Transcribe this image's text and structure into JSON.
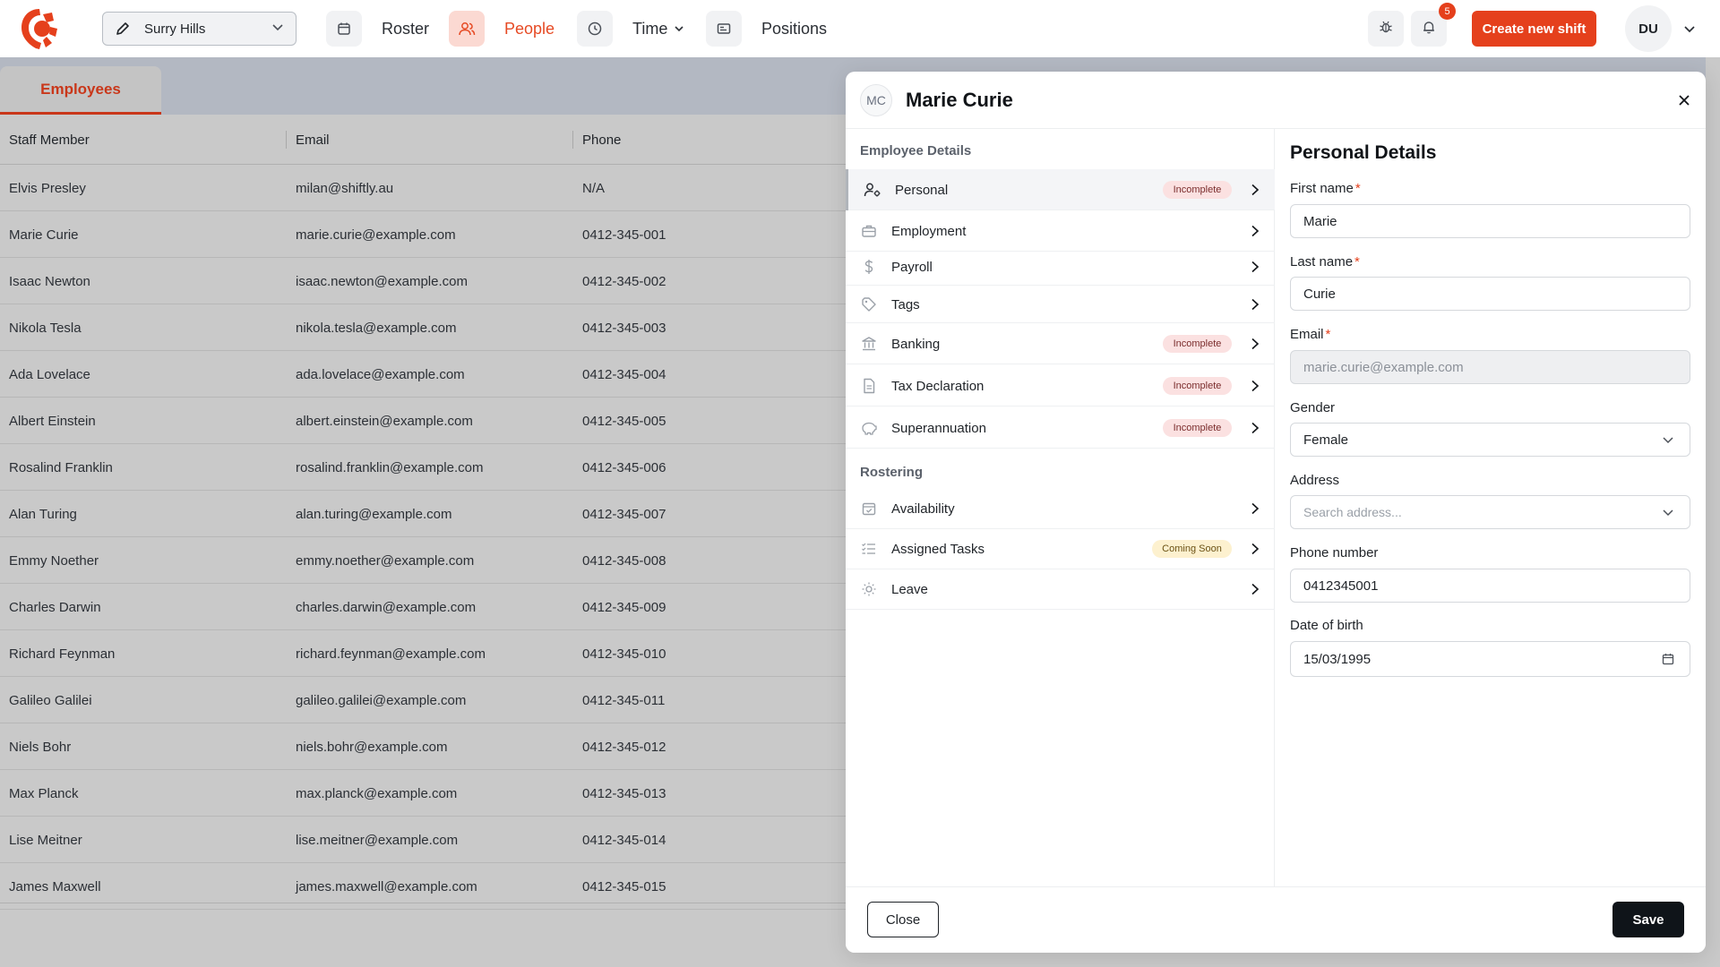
{
  "colors": {
    "brand": "#e5401c",
    "active_nav": "#e64a24",
    "dim_overlay": "#c9c9c9"
  },
  "topbar": {
    "location": "Surry Hills",
    "nav": [
      {
        "label": "Roster",
        "icon": "calendar-icon"
      },
      {
        "label": "People",
        "icon": "people-icon",
        "active": true
      },
      {
        "label": "Time",
        "icon": "clock-icon"
      },
      {
        "label": "Positions",
        "icon": "id-card-icon"
      }
    ],
    "notification_count": "5",
    "create_button": "Create new shift",
    "user_initials": "DU"
  },
  "page": {
    "tab": "Employees",
    "columns": [
      "Staff Member",
      "Email",
      "Phone"
    ],
    "rows": [
      [
        "Elvis Presley",
        "milan@shiftly.au",
        "N/A"
      ],
      [
        "Marie Curie",
        "marie.curie@example.com",
        "0412-345-001"
      ],
      [
        "Isaac Newton",
        "isaac.newton@example.com",
        "0412-345-002"
      ],
      [
        "Nikola Tesla",
        "nikola.tesla@example.com",
        "0412-345-003"
      ],
      [
        "Ada Lovelace",
        "ada.lovelace@example.com",
        "0412-345-004"
      ],
      [
        "Albert Einstein",
        "albert.einstein@example.com",
        "0412-345-005"
      ],
      [
        "Rosalind Franklin",
        "rosalind.franklin@example.com",
        "0412-345-006"
      ],
      [
        "Alan Turing",
        "alan.turing@example.com",
        "0412-345-007"
      ],
      [
        "Emmy Noether",
        "emmy.noether@example.com",
        "0412-345-008"
      ],
      [
        "Charles Darwin",
        "charles.darwin@example.com",
        "0412-345-009"
      ],
      [
        "Richard Feynman",
        "richard.feynman@example.com",
        "0412-345-010"
      ],
      [
        "Galileo Galilei",
        "galileo.galilei@example.com",
        "0412-345-011"
      ],
      [
        "Niels Bohr",
        "niels.bohr@example.com",
        "0412-345-012"
      ],
      [
        "Max Planck",
        "max.planck@example.com",
        "0412-345-013"
      ],
      [
        "Lise Meitner",
        "lise.meitner@example.com",
        "0412-345-014"
      ],
      [
        "James Maxwell",
        "james.maxwell@example.com",
        "0412-345-015"
      ]
    ]
  },
  "modal": {
    "initials": "MC",
    "title": "Marie Curie",
    "employee_details_title": "Employee Details",
    "employee_details": [
      {
        "label": "Personal",
        "icon": "user-cog-icon",
        "status": "Incomplete",
        "active": true
      },
      {
        "label": "Employment",
        "icon": "briefcase-icon",
        "status": ""
      },
      {
        "label": "Payroll",
        "icon": "dollar-icon",
        "status": ""
      },
      {
        "label": "Tags",
        "icon": "tag-icon",
        "status": ""
      },
      {
        "label": "Banking",
        "icon": "bank-icon",
        "status": "Incomplete"
      },
      {
        "label": "Tax Declaration",
        "icon": "document-icon",
        "status": "Incomplete"
      },
      {
        "label": "Superannuation",
        "icon": "piggy-bank-icon",
        "status": "Incomplete"
      }
    ],
    "rostering_title": "Rostering",
    "rostering": [
      {
        "label": "Availability",
        "icon": "calendar-check-icon",
        "status": ""
      },
      {
        "label": "Assigned Tasks",
        "icon": "checklist-icon",
        "status": "Coming Soon"
      },
      {
        "label": "Leave",
        "icon": "sun-icon",
        "status": ""
      }
    ],
    "form": {
      "title": "Personal Details",
      "first_name_label": "First name",
      "first_name": "Marie",
      "last_name_label": "Last name",
      "last_name": "Curie",
      "email_label": "Email",
      "email": "marie.curie@example.com",
      "gender_label": "Gender",
      "gender": "Female",
      "address_label": "Address",
      "address_placeholder": "Search address...",
      "phone_label": "Phone number",
      "phone": "0412345001",
      "dob_label": "Date of birth",
      "dob": "15/03/1995",
      "required_mark": "*"
    },
    "close_button": "Close",
    "save_button": "Save"
  }
}
